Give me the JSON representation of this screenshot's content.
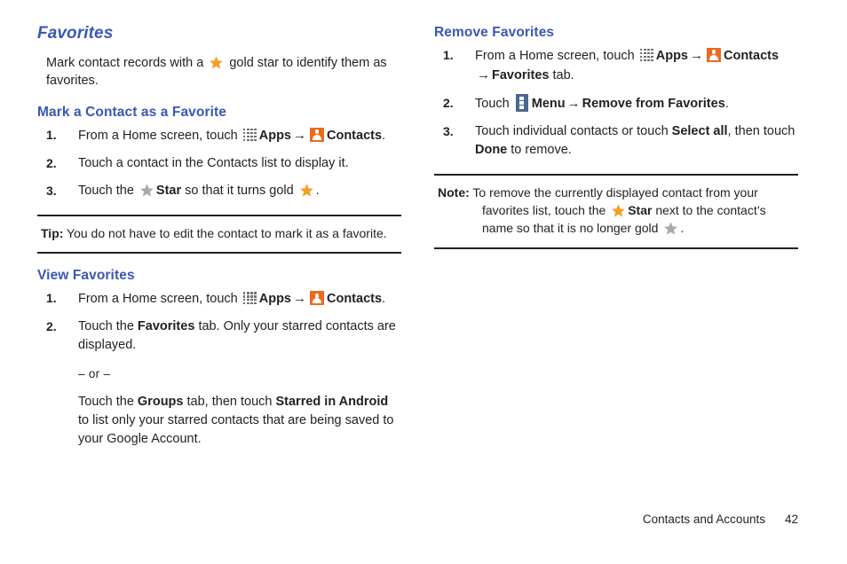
{
  "colors": {
    "heading_blue": "#3b57b5",
    "gold_star": "#f2a02a",
    "gray_star": "#a9aaac",
    "contacts_orange": "#ec6a1f",
    "menu_blue": "#47688f",
    "rule_dark": "#231f20",
    "apps_gray": "#6f7072"
  },
  "left_column": {
    "title": "Favorites",
    "intro": {
      "before_star": "Mark contact records with a",
      "after_star": "gold star to identify them as favorites."
    },
    "section_mark": {
      "heading": "Mark a Contact as a Favorite",
      "steps": [
        {
          "num": "1.",
          "t1": "From a Home screen, touch",
          "apps": "Apps",
          "arrow": "→",
          "contacts": "Contacts",
          "t2": "."
        },
        {
          "num": "2.",
          "t1": "Touch a contact in the Contacts list  to display it."
        },
        {
          "num": "3.",
          "t1": "Touch the",
          "star_label": "Star",
          "t2": "so that it turns gold",
          "t3": "."
        }
      ]
    },
    "tip": {
      "label": "Tip:",
      "text": "You do not have to edit the contact to mark it as a favorite."
    },
    "section_view": {
      "heading": "View Favorites",
      "steps": [
        {
          "num": "1.",
          "t1": "From a Home screen, touch",
          "apps": "Apps",
          "arrow": "→",
          "contacts": "Contacts",
          "t2": "."
        },
        {
          "num": "2.",
          "t1": "Touch the",
          "b1": "Favorites",
          "t2": "tab. Only your starred contacts are displayed.",
          "or_label": "– or –",
          "sub_t1": "Touch the",
          "sub_b1": "Groups",
          "sub_t2": "tab, then touch",
          "sub_b2": "Starred in Android",
          "sub_t3": "to list only your starred contacts that are being saved to your Google Account."
        }
      ]
    }
  },
  "right_column": {
    "section_remove": {
      "heading": "Remove Favorites",
      "steps": [
        {
          "num": "1.",
          "t1": "From a Home screen, touch",
          "apps": "Apps",
          "arrow": "→",
          "contacts": "Contacts",
          "arrow2": "→",
          "b1": "Favorites",
          "t2": "tab."
        },
        {
          "num": "2.",
          "t1": "Touch",
          "menu": "Menu",
          "arrow": "→",
          "b1": "Remove from Favorites",
          "t2": "."
        },
        {
          "num": "3.",
          "t1": "Touch individual contacts or touch",
          "b1": "Select all",
          "t2": ", then touch",
          "b2": "Done",
          "t3": "to remove."
        }
      ]
    },
    "note": {
      "label": "Note:",
      "t1": "To remove the currently displayed contact from your favorites list, touch the",
      "star_label": "Star",
      "t2": "next to the contact’s name so that it is no longer gold",
      "t3": "."
    }
  },
  "footer": {
    "label": "Contacts and Accounts",
    "page": "42"
  }
}
